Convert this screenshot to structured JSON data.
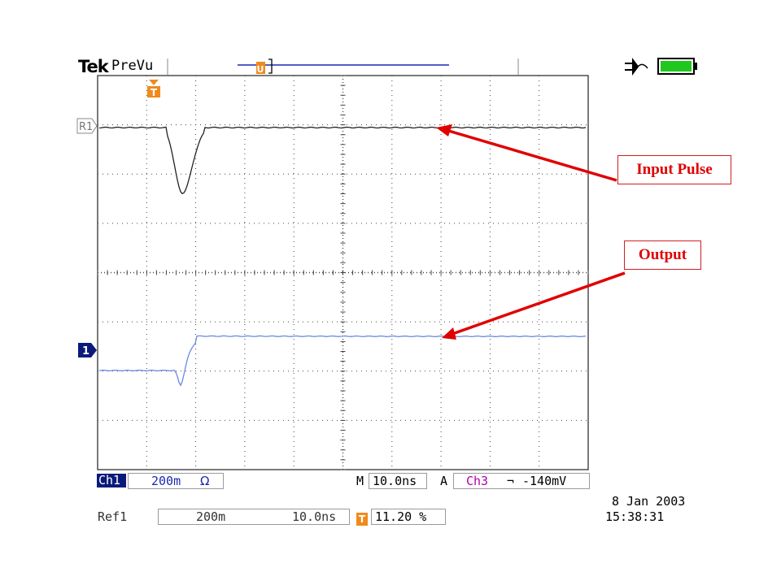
{
  "header": {
    "brand": "Tek",
    "mode": "PreVu",
    "trigger_marker": "T"
  },
  "graticule": {
    "ref_marker_label": "R1",
    "channel_marker_label": "1"
  },
  "traces": {
    "input_pulse": {
      "color": "#222222"
    },
    "output": {
      "color": "#6a8ae0"
    }
  },
  "annotations": {
    "input_pulse": "Input Pulse",
    "output": "Output"
  },
  "readout": {
    "ch1_label": "Ch1",
    "ch1_scale": "200m",
    "ch1_coupling_symbol": "Ω",
    "timebase_label": "M",
    "timebase_value": "10.0ns",
    "trigger_label": "A",
    "trigger_source": "Ch3",
    "trigger_slope_symbol": "⌐",
    "trigger_level": "-140mV",
    "ref1_label": "Ref1",
    "ref1_scale": "200m",
    "ref1_time": "10.0ns",
    "trigger_position_icon": "T",
    "trigger_position": "11.20 %",
    "date": "8 Jan  2003",
    "time": "15:38:31"
  },
  "status": {
    "power_icon": "power-plug-icon",
    "battery_icon": "battery-icon",
    "battery_level": 1.0,
    "colors": {
      "battery": "#1ec81e",
      "channel_badge": "#0b1a7a",
      "trigger": "#f08a1c",
      "arrow": "#e00000"
    }
  }
}
